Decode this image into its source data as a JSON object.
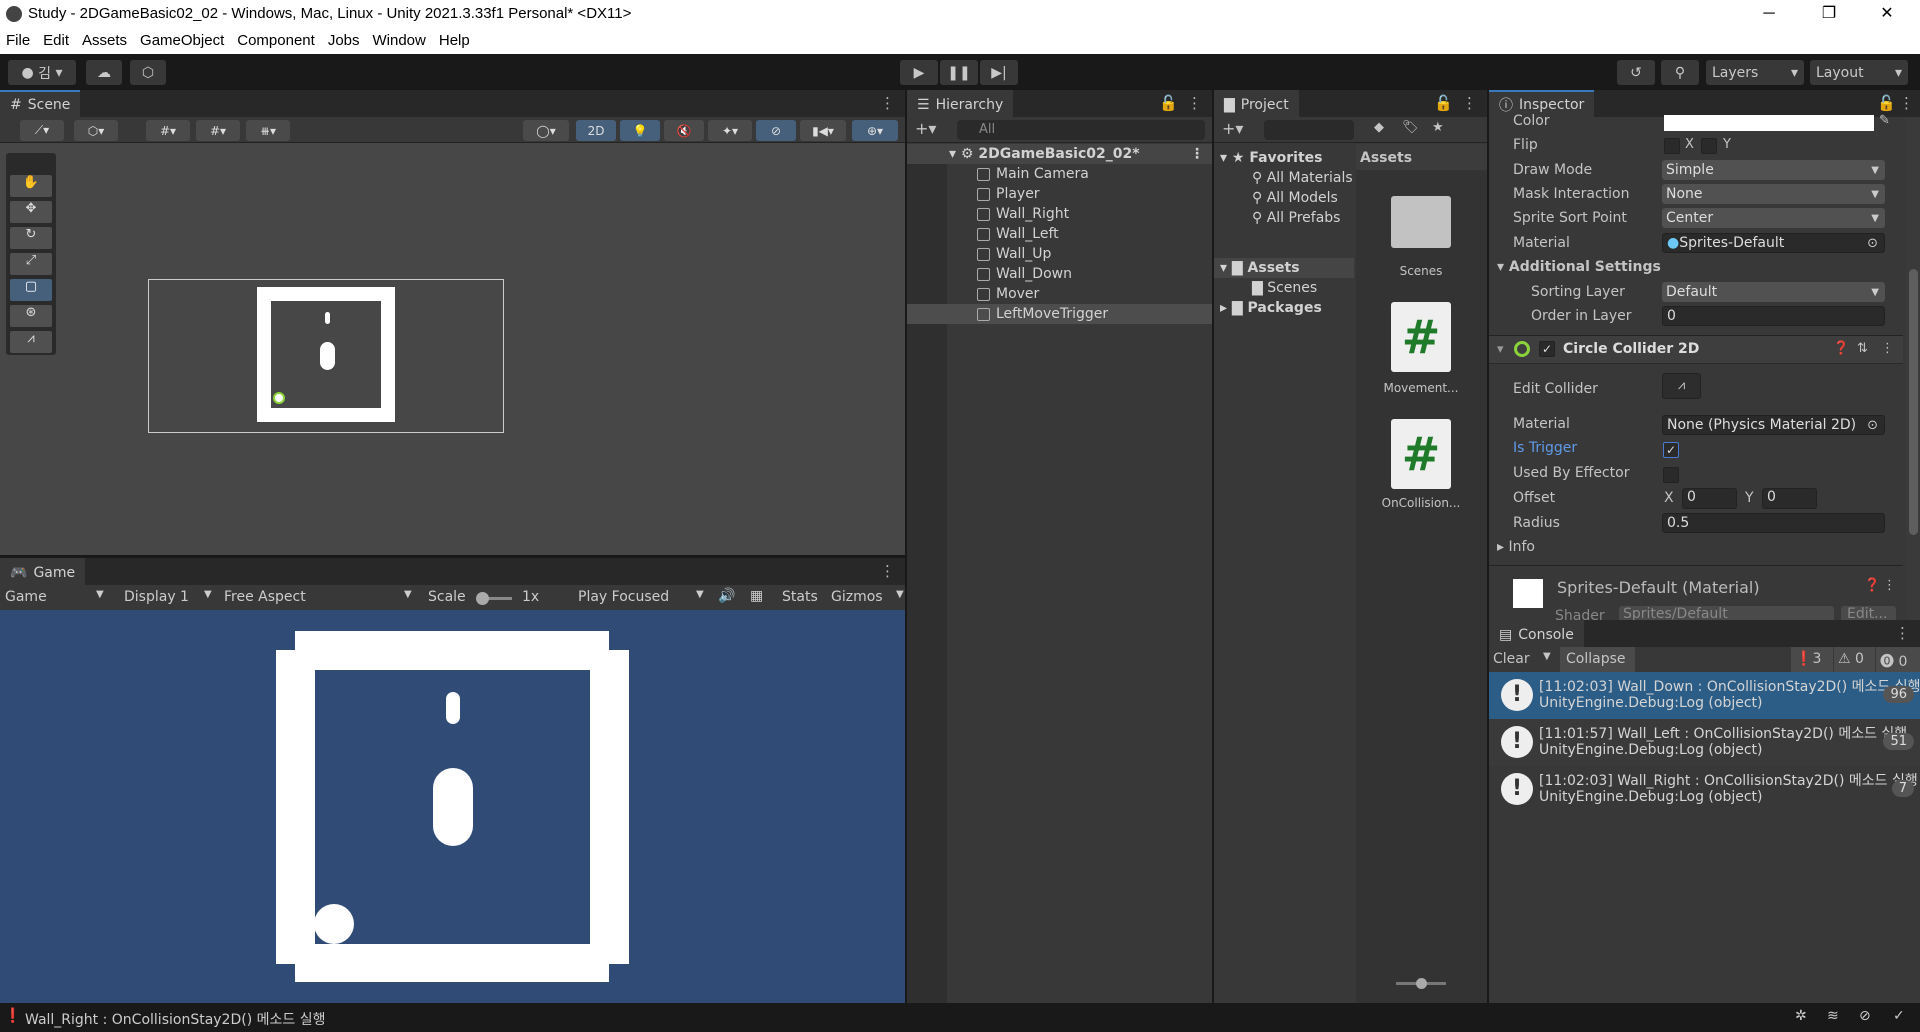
{
  "window": {
    "title": "Study - 2DGameBasic02_02 - Windows, Mac, Linux - Unity 2021.3.33f1 Personal* <DX11>",
    "minimize": "─",
    "maximize": "❐",
    "close": "✕"
  },
  "menu": [
    "File",
    "Edit",
    "Assets",
    "GameObject",
    "Component",
    "Jobs",
    "Window",
    "Help"
  ],
  "toolbar": {
    "account": "김",
    "layers": "Layers",
    "layout": "Layout"
  },
  "scene": {
    "tab": "Scene",
    "mode2d": "2D"
  },
  "game": {
    "tab": "Game",
    "mode": "Game",
    "display": "Display 1",
    "aspect": "Free Aspect",
    "scale_label": "Scale",
    "scale_value": "1x",
    "play_mode": "Play Focused",
    "stats": "Stats",
    "gizmos": "Gizmos",
    "bg_color": "#2f4b76"
  },
  "hierarchy": {
    "tab": "Hierarchy",
    "search_placeholder": "All",
    "scene": "2DGameBasic02_02*",
    "items": [
      "Main Camera",
      "Player",
      "Wall_Right",
      "Wall_Left",
      "Wall_Up",
      "Wall_Down",
      "Mover",
      "LeftMoveTrigger"
    ],
    "selected": "LeftMoveTrigger"
  },
  "project": {
    "tab": "Project",
    "favorites": "Favorites",
    "fav_items": [
      "All Materials",
      "All Models",
      "All Prefabs"
    ],
    "assets": "Assets",
    "scenes": "Scenes",
    "packages": "Packages",
    "assets_header": "Assets",
    "grid": [
      "Scenes",
      "Movement...",
      "OnCollision..."
    ]
  },
  "inspector": {
    "tab": "Inspector",
    "sprite": {
      "color_label": "Color",
      "flip_label": "Flip",
      "flip_x": "X",
      "flip_y": "Y",
      "draw_mode_label": "Draw Mode",
      "draw_mode": "Simple",
      "mask_label": "Mask Interaction",
      "mask": "None",
      "sort_point_label": "Sprite Sort Point",
      "sort_point": "Center",
      "material_label": "Material",
      "material": "Sprites-Default",
      "additional": "Additional Settings",
      "sorting_layer_label": "Sorting Layer",
      "sorting_layer": "Default",
      "order_label": "Order in Layer",
      "order": "0"
    },
    "collider": {
      "title": "Circle Collider 2D",
      "enabled": true,
      "edit_label": "Edit Collider",
      "material_label": "Material",
      "material": "None (Physics Material 2D)",
      "trigger_label": "Is Trigger",
      "is_trigger": true,
      "effector_label": "Used By Effector",
      "used_by_effector": false,
      "offset_label": "Offset",
      "offset_x_label": "X",
      "offset_x": "0",
      "offset_y_label": "Y",
      "offset_y": "0",
      "radius_label": "Radius",
      "radius": "0.5",
      "info": "Info"
    },
    "material_preview": {
      "title": "Sprites-Default (Material)",
      "shader_label": "Shader",
      "shader": "Sprites/Default",
      "edit": "Edit..."
    }
  },
  "console": {
    "tab": "Console",
    "clear": "Clear",
    "collapse": "Collapse",
    "log_count": "3",
    "warn_count": "0",
    "error_count": "0",
    "entries": [
      {
        "line1": "[11:02:03] Wall_Down : OnCollisionStay2D() 메소드 실행",
        "line2": "UnityEngine.Debug:Log (object)",
        "count": "96",
        "selected": true
      },
      {
        "line1": "[11:01:57] Wall_Left : OnCollisionStay2D() 메소드 실행",
        "line2": "UnityEngine.Debug:Log (object)",
        "count": "51"
      },
      {
        "line1": "[11:02:03] Wall_Right : OnCollisionStay2D() 메소드 실행",
        "line2": "UnityEngine.Debug:Log (object)",
        "count": "7"
      }
    ]
  },
  "status": {
    "message": "Wall_Right : OnCollisionStay2D() 메소드 실행"
  },
  "colors": {
    "accent": "#2c5d87",
    "selected_row": "#4d4d4d",
    "trigger_label": "#5f9ae8",
    "collider_icon": "#8bd33a"
  }
}
